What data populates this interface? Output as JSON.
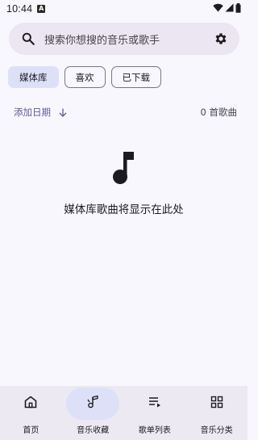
{
  "status_bar": {
    "time": "10:44",
    "notification_badge": "A",
    "icons": [
      "wifi-icon",
      "signal-icon",
      "battery-icon"
    ]
  },
  "search": {
    "placeholder": "搜索你想搜的音乐或歌手",
    "icon": "search-icon",
    "settings_icon": "gear-icon"
  },
  "chips": [
    {
      "label": "媒体库",
      "selected": true
    },
    {
      "label": "喜欢",
      "selected": false
    },
    {
      "label": "已下载",
      "selected": false
    }
  ],
  "sort": {
    "label": "添加日期",
    "direction_icon": "arrow-down-icon",
    "count": "0 首歌曲"
  },
  "empty_state": {
    "icon": "music-note-icon",
    "message": "媒体库歌曲将显示在此处"
  },
  "bottom_nav": [
    {
      "label": "首页",
      "icon": "home-icon",
      "active": false
    },
    {
      "label": "音乐收藏",
      "icon": "music-library-icon",
      "active": true
    },
    {
      "label": "歌单列表",
      "icon": "playlist-icon",
      "active": false
    },
    {
      "label": "音乐分类",
      "icon": "category-grid-icon",
      "active": false
    }
  ],
  "colors": {
    "background": "#f9f7fe",
    "accent_container": "#dde1f8",
    "accent_text": "#5b5c93",
    "search_bg": "#ebe6f1",
    "nav_bg": "#ece9f2"
  }
}
